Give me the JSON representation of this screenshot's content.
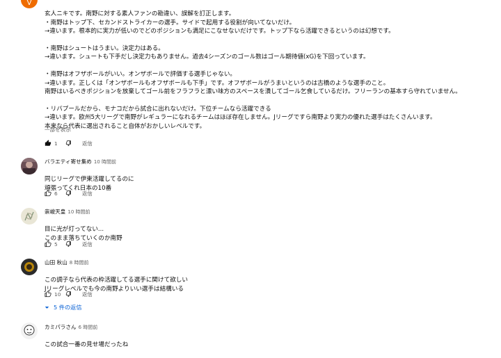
{
  "comments": [
    {
      "text_lines": [
        "玄人ニキです。南野に対する素人ファンの勘違い、誤解を訂正します。",
        "・南野はトップ下、セカンドストライカーの選手。サイドで起用する役割が向いてないだけ。",
        "→違います。根本的に実力が低いのでどのポジションも満足にこなせないだけです。トップ下なら活躍できるというのは幻想です。",
        "",
        "・南野はシュートはうまい。決定力はある。",
        "→違います。シュートも下手だし決定力もありません。過去4シーズンのゴール数はゴール期待値(xG)を下回っています。",
        "",
        "・南野はオフザボールがいい。オンザボールで評価する選手じゃない。",
        "→違います。正しくは「オンザボールもオフザボールも下手」です。オフザボールがうまいというのは古橋のような選手のこと。",
        "南野はいるべきポジションを放棄してゴール前をフラフラと漂い味方のスペースを潰してゴール乞食しているだけ。フリーランの基本すら守れていません。",
        "",
        "・リバプールだから、モナコだから試合に出れないだけ。下位チームなら活躍できる",
        "→違います。欧州5大リーグで南野がレギュラーになれるチームはほぼ存在しません。Jリーグですら南野より実力の優れた選手はたくさんいます。",
        "本来なら代表に選出されること自体がおかしいレベルです。"
      ],
      "show_more": "一部を表示",
      "likes": "1",
      "reply_label": "返信"
    },
    {
      "author": "バラエティ寄せ集め",
      "time": "10 時間前",
      "text_lines": [
        "同じリーグで伊東活躍してるのに",
        "頑張ってくれ日本の10番"
      ],
      "likes": "6",
      "reply_label": "返信"
    },
    {
      "author": "崇峻天皇",
      "time": "10 時間前",
      "text_lines": [
        "目に光が灯ってない...",
        "このまま落ちていくのか南野"
      ],
      "likes": "5",
      "reply_label": "返信"
    },
    {
      "author": "山田 秋山",
      "time": "8 時間前",
      "text_lines": [
        "この調子なら代表の枠活躍してる選手に関けて欲しい",
        "Jリーグレベルでも今の南野よりいい選手は結構いる"
      ],
      "likes": "10",
      "reply_label": "返信",
      "replies_link": "5 件の返信"
    },
    {
      "author": "カミパラさん",
      "time": "6 時間前",
      "text_lines": [
        "この試合一番の見せ場だったね"
      ]
    }
  ],
  "colors": {
    "link": "#065fd4",
    "muted": "#606060",
    "avatar1": "#ef6c00"
  }
}
